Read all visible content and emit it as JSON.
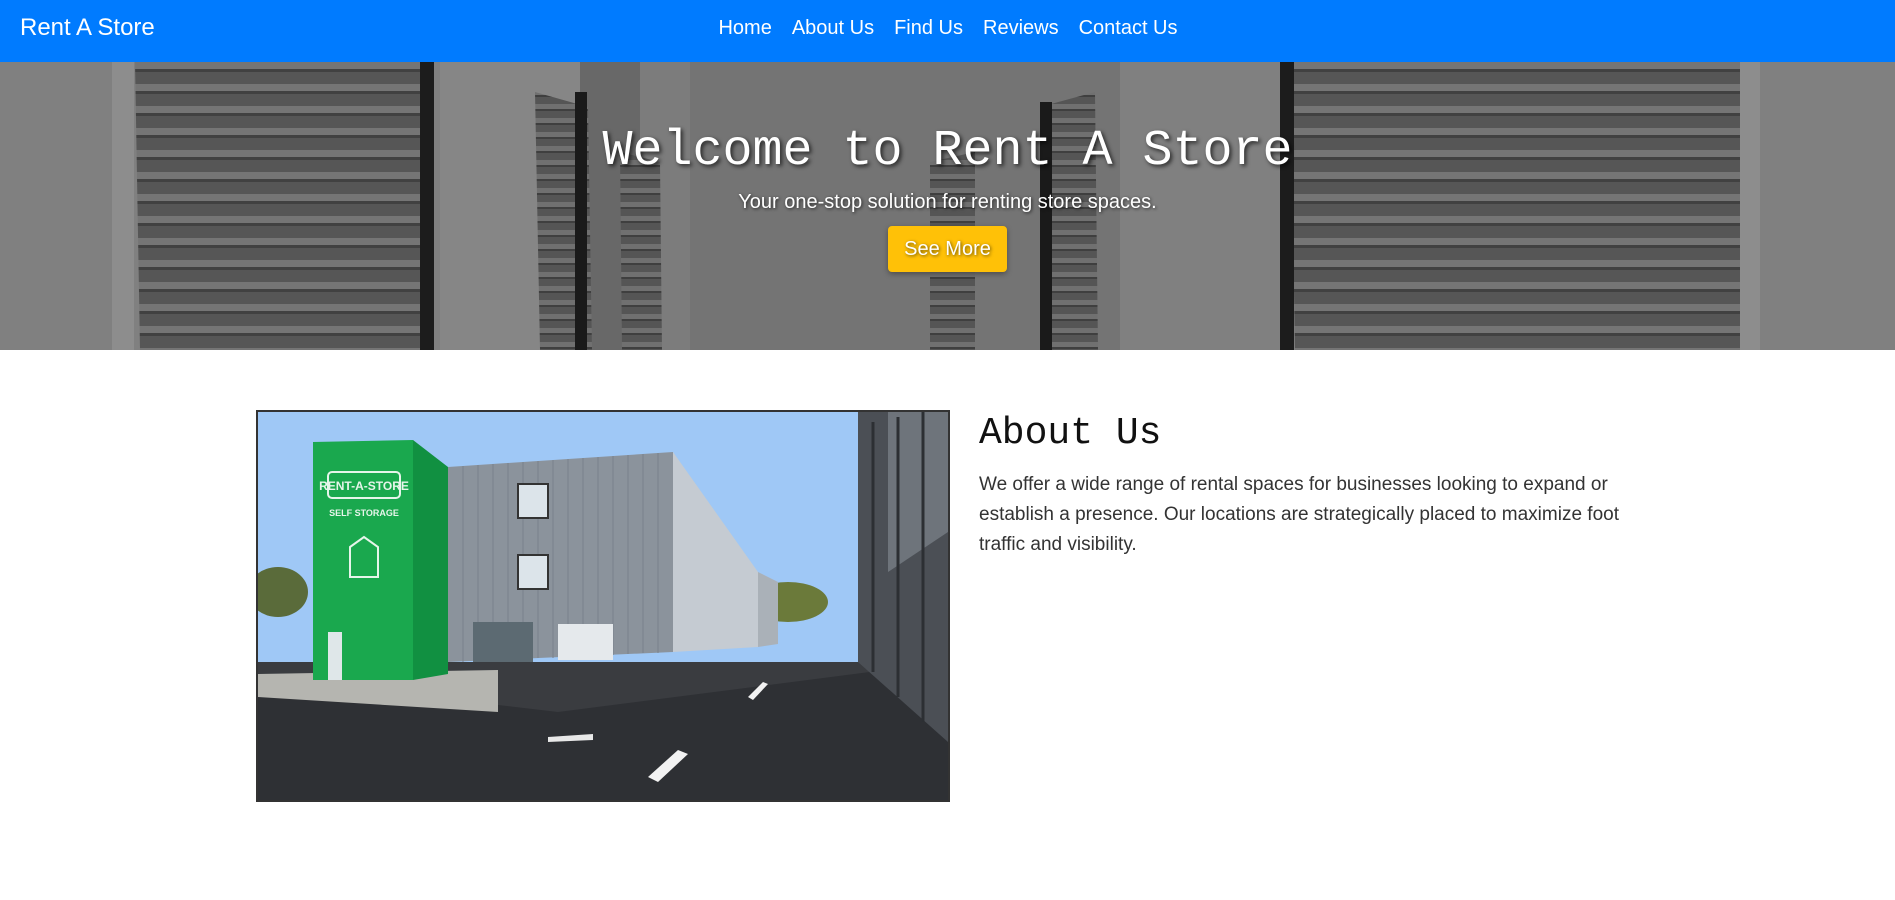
{
  "navbar": {
    "brand": "Rent A Store",
    "links": [
      "Home",
      "About Us",
      "Find Us",
      "Reviews",
      "Contact Us"
    ],
    "background_color": "#007bff"
  },
  "hero": {
    "title": "Welcome to Rent A Store",
    "subtitle": "Your one-stop solution for renting store spaces.",
    "button_label": "See More",
    "button_color": "#ffc107"
  },
  "about": {
    "title": "About Us",
    "body": "We offer a wide range of rental spaces for businesses looking to expand or establish a presence. Our locations are strategically placed to maximize foot traffic and visibility.",
    "photo_sign": {
      "logo": "RENT-A-STORE",
      "tagline": "SELF STORAGE"
    }
  }
}
